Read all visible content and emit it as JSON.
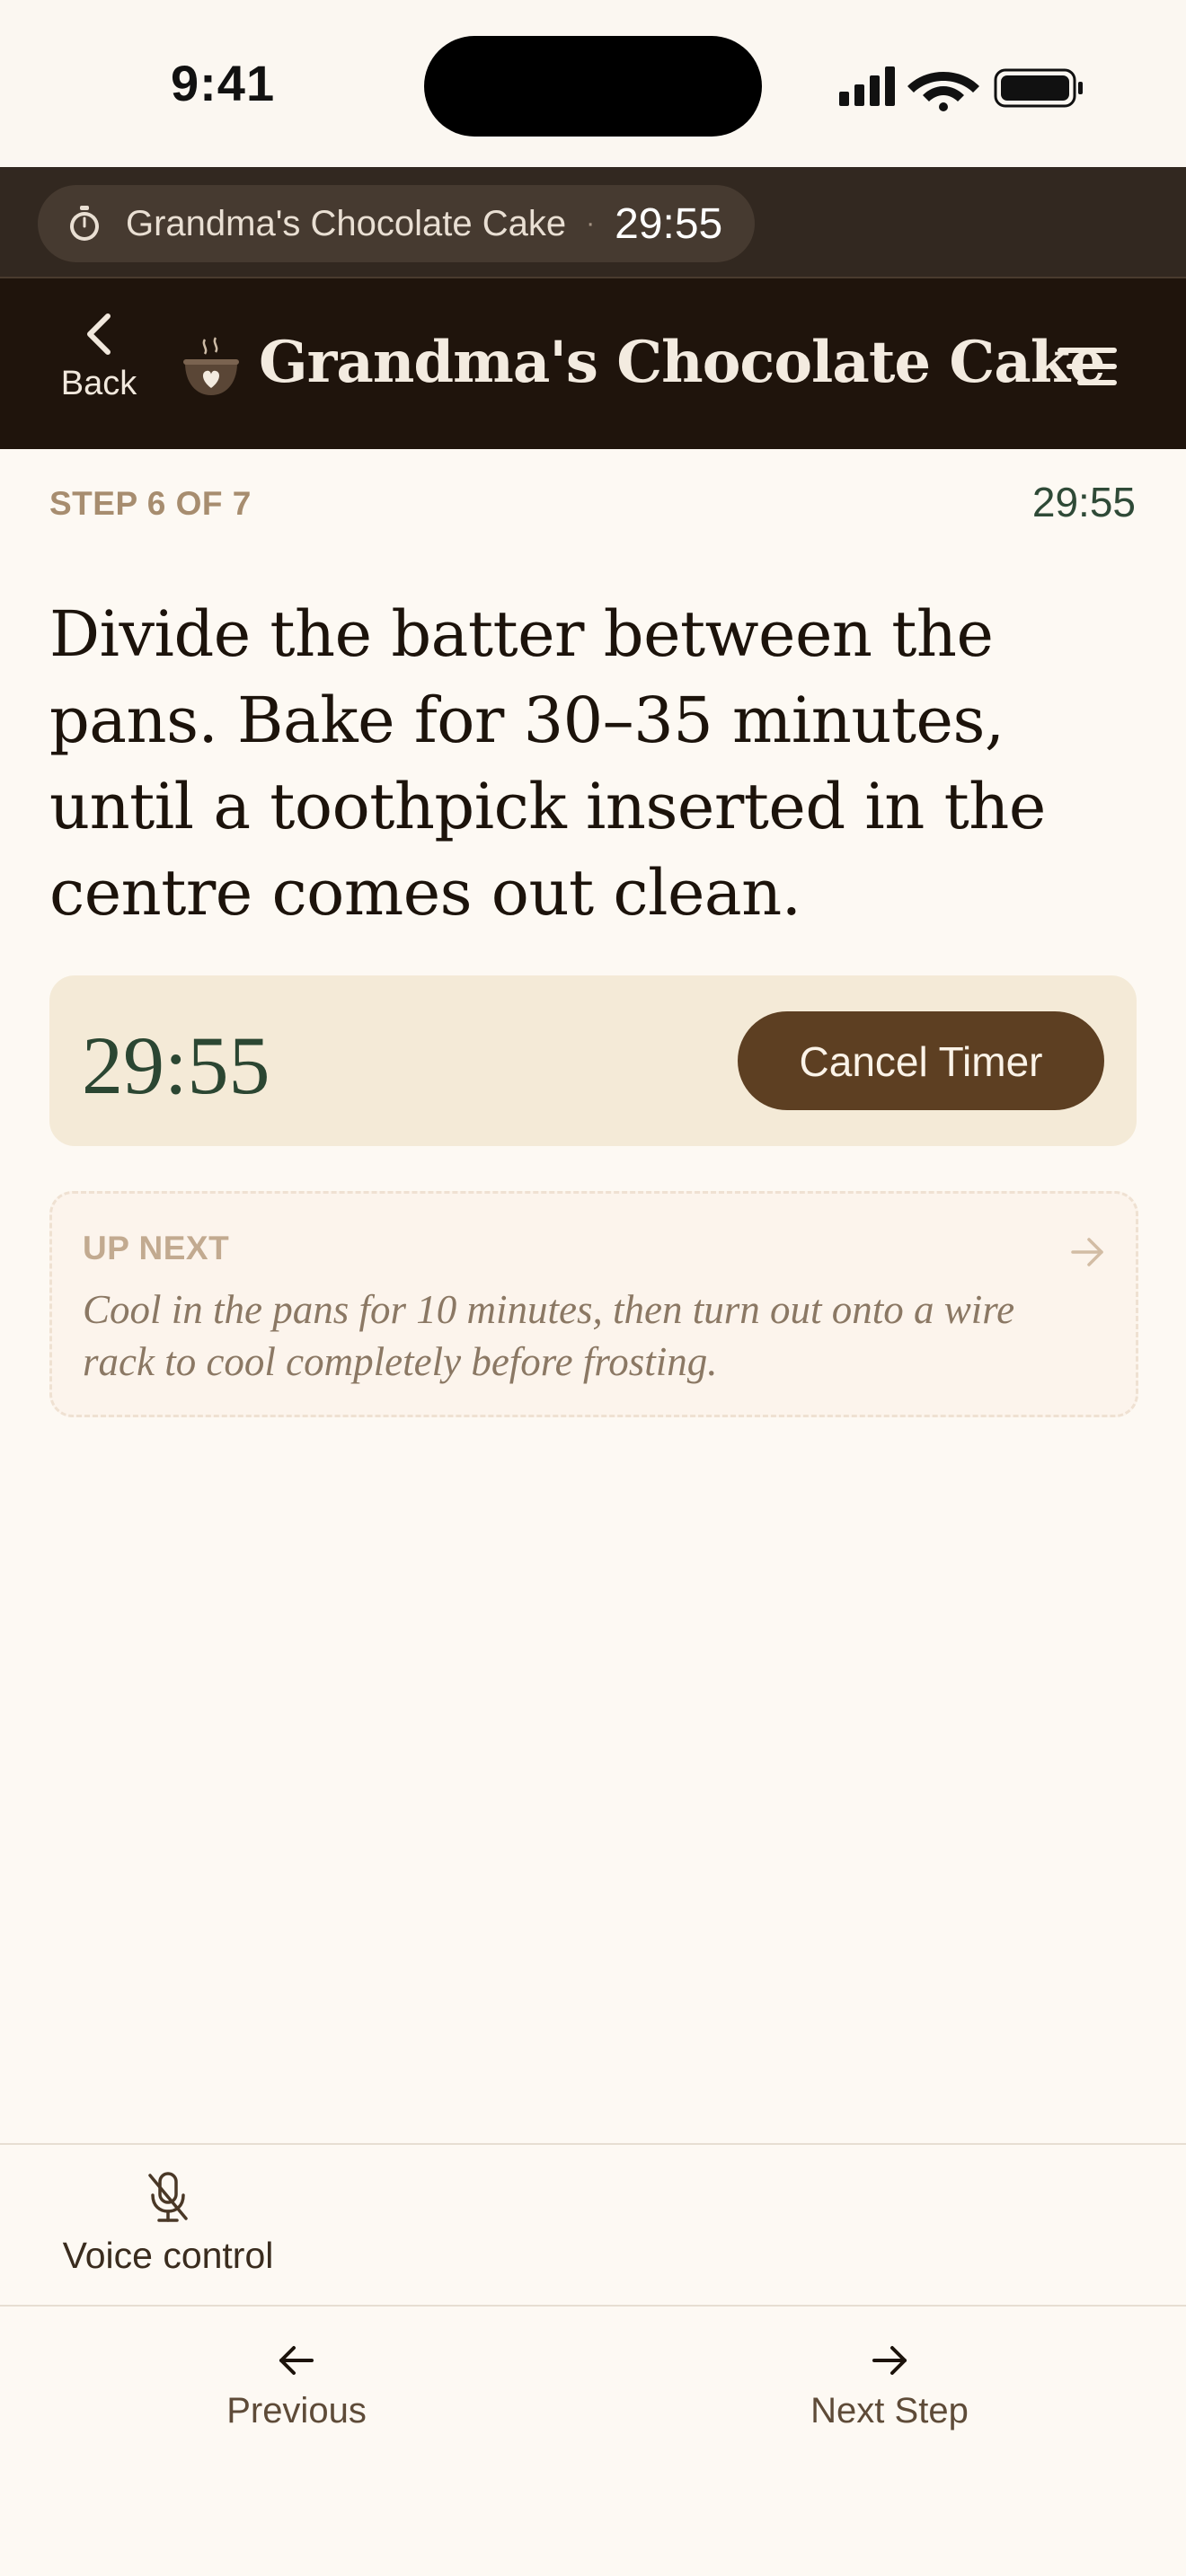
{
  "status_bar": {
    "time": "9:41",
    "icons": [
      "signal-icon",
      "wifi-icon",
      "battery-icon"
    ]
  },
  "activity": {
    "icon": "stopwatch-icon",
    "title": "Grandma's Chocolate Cake",
    "separator": "·",
    "time": "29:55"
  },
  "header": {
    "back_label": "Back",
    "title": "Grandma's Chocolate Cake",
    "logo_icon": "bowl-heart-icon",
    "menu_icon": "menu-icon"
  },
  "step": {
    "label": "STEP 6 OF 7",
    "time": "29:55",
    "instruction": "Divide the batter between the pans. Bake for 30–35 minutes, until a toothpick inserted in the centre comes out clean."
  },
  "timer": {
    "value": "29:55",
    "cancel_label": "Cancel Timer"
  },
  "up_next": {
    "label": "UP NEXT",
    "text": "Cool in the pans for 10 minutes, then turn out onto a wire rack to cool completely before frosting."
  },
  "voice": {
    "label": "Voice control",
    "icon": "mic-off-icon"
  },
  "nav": {
    "previous_label": "Previous",
    "next_label": "Next Step"
  },
  "colors": {
    "header_bg": "#1f140c",
    "accent_brown": "#5d3f22",
    "timer_green": "#2b4632",
    "page_bg": "#fdf9f3"
  }
}
